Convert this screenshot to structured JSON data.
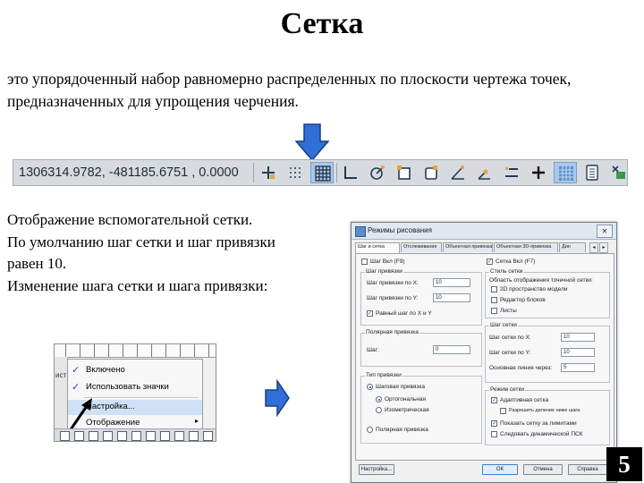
{
  "slide": {
    "title": "Сетка",
    "intro": "это упорядоченный набор равномерно распределенных по плоскости чертежа точек, предназначенных для упрощения черчения.",
    "body_lines": [
      "Отображение вспомогательной сетки.",
      "По умолчанию шаг сетки и шаг привязки",
      "равен 10.",
      "Изменение шага сетки и шага привязки:"
    ],
    "page_number": "5",
    "accent_color": "#2f6fd6"
  },
  "statusbar": {
    "coordinates": "1306314.9782, -481185.6751 , 0.0000",
    "buttons": [
      {
        "icon": "snap-mode-icon",
        "active": false
      },
      {
        "icon": "grid-dots-icon",
        "active": false
      },
      {
        "icon": "grid-display-icon",
        "active": true
      },
      {
        "icon": "ortho-icon",
        "active": false
      },
      {
        "icon": "polar-tracking-icon",
        "active": false
      },
      {
        "icon": "object-snap-icon",
        "active": false
      },
      {
        "icon": "3d-snap-icon",
        "active": false
      },
      {
        "icon": "object-snap-tracking-icon",
        "active": false
      },
      {
        "icon": "dynamic-ucs-icon",
        "active": false
      },
      {
        "icon": "dynamic-input-icon",
        "active": false
      },
      {
        "icon": "lineweight-icon",
        "active": false
      },
      {
        "icon": "crosshair-icon",
        "active": false
      },
      {
        "icon": "transparency-icon",
        "active": true
      },
      {
        "icon": "selection-cycling-icon",
        "active": false
      },
      {
        "icon": "annotation-monitor-icon",
        "active": false
      }
    ]
  },
  "context_menu": {
    "left_label": "ист",
    "items": [
      {
        "label": "Включено",
        "checked": true,
        "highlighted": false,
        "submenu": false
      },
      {
        "label": "Использовать значки",
        "checked": true,
        "highlighted": false,
        "submenu": false
      },
      {
        "label": "Настройка...",
        "checked": false,
        "highlighted": true,
        "submenu": false
      },
      {
        "label": "Отображение",
        "checked": false,
        "highlighted": false,
        "submenu": true
      }
    ]
  },
  "dialog": {
    "title": "Режимы рисования",
    "close": "✕",
    "tabs": [
      "Шаг и сетка",
      "Отслеживание",
      "Объектная привязка",
      "Объектная 3D-привязка",
      "Дин"
    ],
    "left": {
      "snap_on_label": "Шаг Вкл (F9)",
      "snap_group": "Шаг привязки",
      "snap_x_label": "Шаг привязки по X:",
      "snap_x_value": "10",
      "snap_y_label": "Шаг привязки по Y:",
      "snap_y_value": "10",
      "equal_xy_label": "Равный шаг по X и Y",
      "polar_group": "Полярная привязка",
      "polar_dist_label": "Шаг:",
      "polar_dist_value": "0",
      "type_group": "Тип привязки",
      "grid_snap_label": "Шаговая привязка",
      "rect_label": "Ортогональная",
      "iso_label": "Изометрическая",
      "polar_snap_label": "Полярная привязка"
    },
    "right": {
      "grid_on_label": "Сетка Вкл (F7)",
      "style_group": "Стиль сетки",
      "style_caption": "Область отображения точечной сетки:",
      "style_model": "2D пространство модели",
      "style_block": "Редактор блоков",
      "style_sheet": "Листы",
      "spacing_group": "Шаг сетки",
      "grid_x_label": "Шаг сетки по X:",
      "grid_x_value": "10",
      "grid_y_label": "Шаг сетки по Y:",
      "grid_y_value": "10",
      "major_label": "Основная линия через:",
      "major_value": "5",
      "behavior_group": "Режим сетки",
      "adaptive_label": "Адаптивная сетка",
      "subdivide_label": "Разрешить деление ниже шага",
      "beyond_label": "Показать сетку за лимитами",
      "ucs_label": "Следовать динамической ПСК"
    },
    "buttons": {
      "options": "Настройка...",
      "ok": "ОК",
      "cancel": "Отмена",
      "help": "Справка"
    }
  }
}
